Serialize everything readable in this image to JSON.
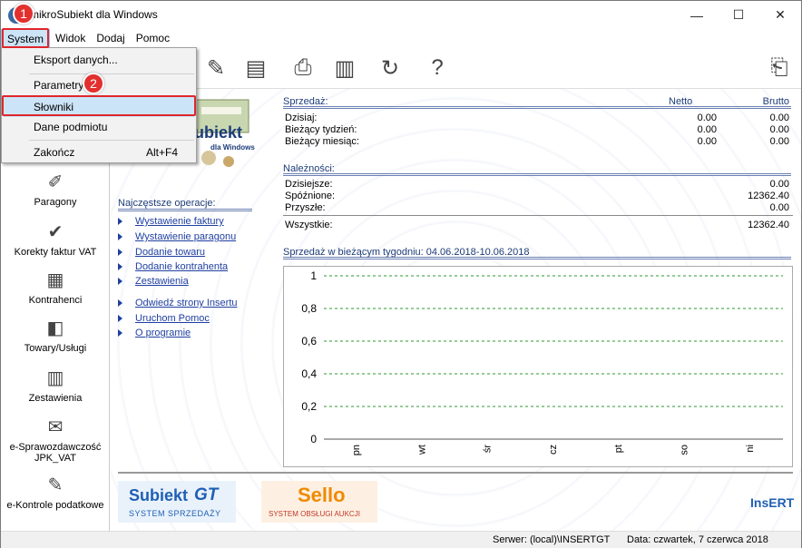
{
  "window": {
    "title": "mikroSubiekt dla Windows",
    "minimize_glyph": "—",
    "maximize_glyph": "☐",
    "close_glyph": "✕"
  },
  "menubar": {
    "items": [
      "System",
      "Widok",
      "Dodaj",
      "Pomoc"
    ]
  },
  "system_menu": {
    "items": [
      {
        "label": "Eksport danych...",
        "shortcut": ""
      },
      {
        "label": "Parametry",
        "shortcut": ""
      },
      {
        "label": "Słowniki",
        "shortcut": ""
      },
      {
        "label": "Dane podmiotu",
        "shortcut": ""
      },
      {
        "label": "Zakończ",
        "shortcut": "Alt+F4"
      }
    ]
  },
  "annotations": {
    "badge1": "1",
    "badge2": "2",
    "color": "#e0262b"
  },
  "toolbar": {
    "icons": [
      "pen-icon",
      "printer-icon",
      "print-setup-icon",
      "printer2-icon",
      "refresh-icon",
      "help-icon",
      "exit-icon"
    ]
  },
  "sidebar": {
    "items": [
      {
        "label": "Paragony",
        "icon": "receipt-icon"
      },
      {
        "label": "Korekty faktur VAT",
        "icon": "correction-icon"
      },
      {
        "label": "Kontrahenci",
        "icon": "contacts-icon"
      },
      {
        "label": "Towary/Usługi",
        "icon": "goods-icon"
      },
      {
        "label": "Zestawienia",
        "icon": "reports-icon"
      },
      {
        "label": "e-Sprawozdawczość JPK_VAT",
        "icon": "jpk-icon"
      },
      {
        "label": "e-Kontrole podatkowe",
        "icon": "tax-control-icon"
      }
    ]
  },
  "logo": {
    "name": "ubiekt",
    "sub": "dla Windows"
  },
  "operations": {
    "title": "Najczęstsze operacje:",
    "links": [
      "Wystawienie faktury",
      "Wystawienie paragonu",
      "Dodanie towaru",
      "Dodanie kontrahenta",
      "Zestawienia",
      "Odwiedź strony Insertu",
      "Uruchom Pomoc",
      "O programie"
    ]
  },
  "sales": {
    "title": "Sprzedaż:",
    "col_net": "Netto",
    "col_gross": "Brutto",
    "rows": [
      {
        "label": "Dzisiaj:",
        "net": "0.00",
        "gross": "0.00"
      },
      {
        "label": "Bieżący tydzień:",
        "net": "0.00",
        "gross": "0.00"
      },
      {
        "label": "Bieżący miesiąc:",
        "net": "0.00",
        "gross": "0.00"
      }
    ]
  },
  "receivables": {
    "title": "Należności:",
    "rows": [
      {
        "label": "Dzisiejsze:",
        "value": "0.00"
      },
      {
        "label": "Spóźnione:",
        "value": "12362.40"
      },
      {
        "label": "Przyszłe:",
        "value": "0.00"
      }
    ],
    "total_label": "Wszystkie:",
    "total_value": "12362.40"
  },
  "chart_data": {
    "type": "line",
    "title": "Sprzedaż w bieżącym tygodniu: 04.06.2018-10.06.2018",
    "categories": [
      "pn",
      "wt",
      "śr",
      "cz",
      "pt",
      "so",
      "ni"
    ],
    "yticks": [
      "1",
      "0,8",
      "0,6",
      "0,4",
      "0,2",
      "0"
    ],
    "ylim": [
      0,
      1
    ],
    "series": [],
    "grid": true,
    "grid_color": "#2e9a2e"
  },
  "footer": {
    "gt_name": "Subiekt",
    "gt_suffix": "GT",
    "gt_caption": "SYSTEM SPRZEDAŻY",
    "sello_name": "Sello",
    "sello_caption": "SYSTEM OBSŁUGI AUKCJI",
    "insert": "InsERT"
  },
  "status": {
    "server": "Serwer: (local)\\INSERTGT",
    "date": "Data: czwartek, 7 czerwca 2018"
  }
}
